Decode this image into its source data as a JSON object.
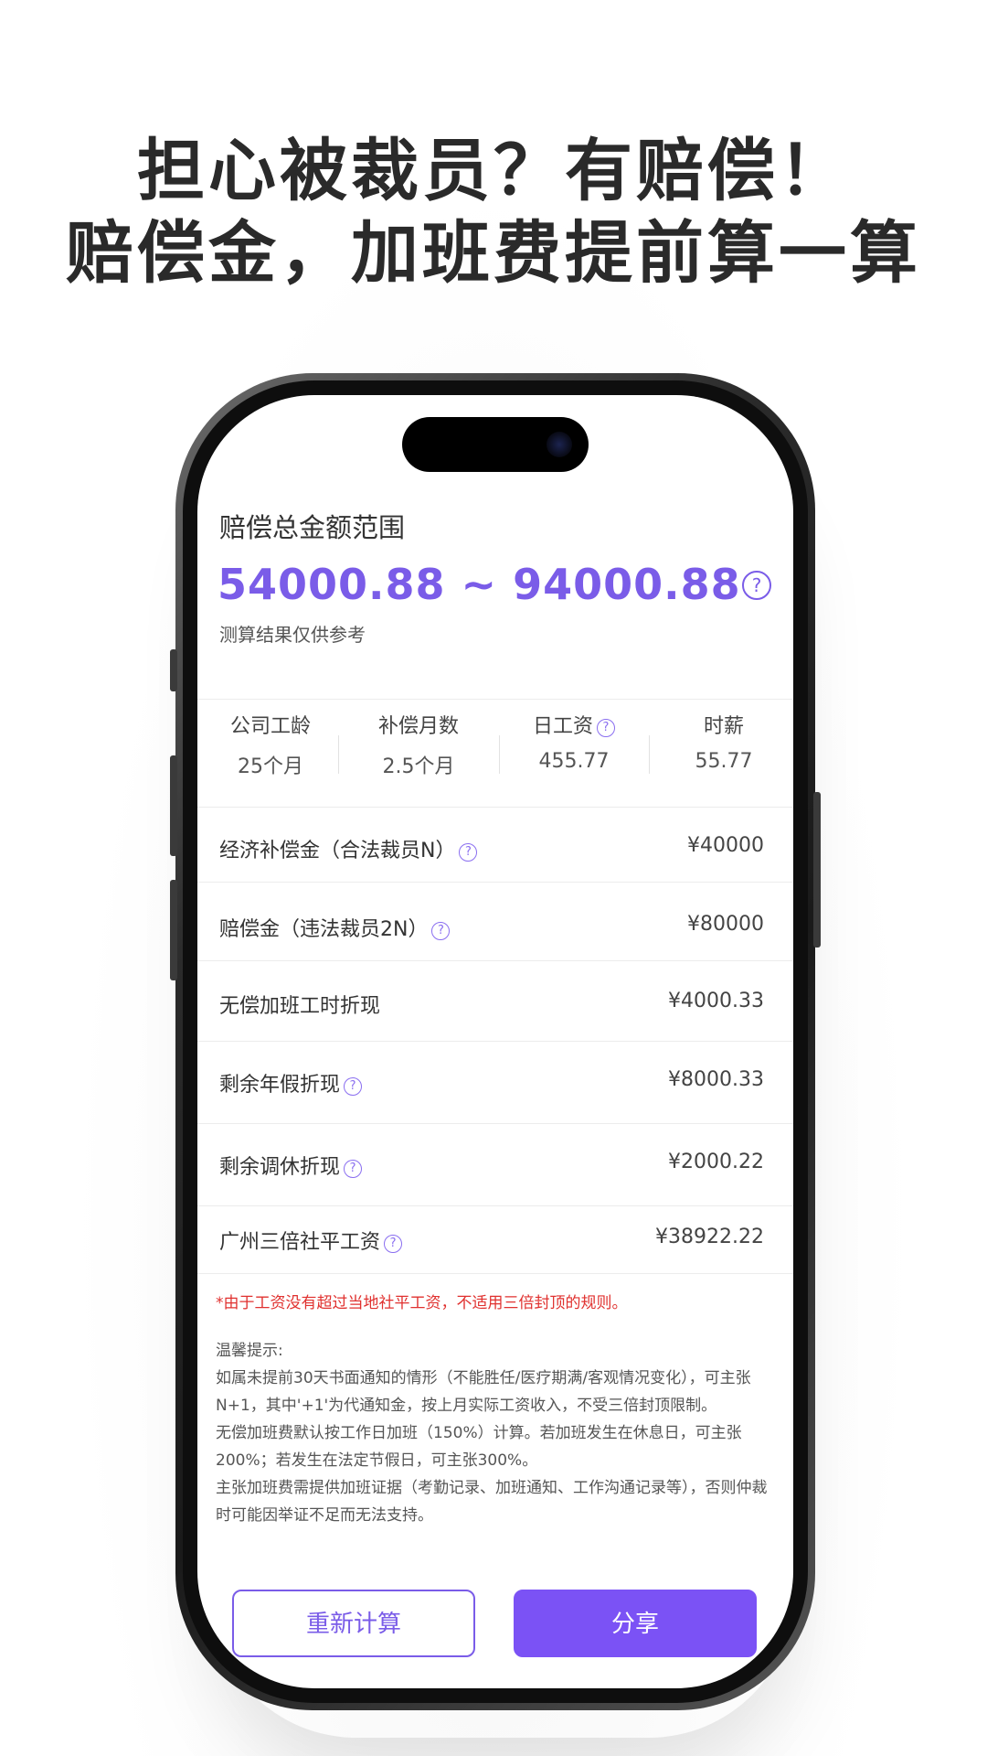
{
  "headline": {
    "line1": "担心被裁员？有赔偿！",
    "line2": "赔偿金，加班费提前算一算"
  },
  "result": {
    "title": "赔偿总金额范围",
    "amount": "54000.88 ~ 94000.88",
    "note": "测算结果仅供参考",
    "help_icon": "question-circle-icon"
  },
  "stats": [
    {
      "label": "公司工龄",
      "value": "25个月",
      "has_help": false
    },
    {
      "label": "补偿月数",
      "value": "2.5个月",
      "has_help": false
    },
    {
      "label": "日工资",
      "value": "455.77",
      "has_help": true
    },
    {
      "label": "时薪",
      "value": "55.77",
      "has_help": false
    }
  ],
  "rows": [
    {
      "label": "经济补偿金（合法裁员N）",
      "value": "¥40000",
      "has_help": true
    },
    {
      "label": "赔偿金（违法裁员2N）",
      "value": "¥80000",
      "has_help": true
    },
    {
      "label": "无偿加班工时折现",
      "value": "¥4000.33",
      "has_help": false
    },
    {
      "label": "剩余年假折现",
      "value": "¥8000.33",
      "has_help": true
    },
    {
      "label": "剩余调休折现",
      "value": "¥2000.22",
      "has_help": true
    },
    {
      "label": "广州三倍社平工资",
      "value": "¥38922.22",
      "has_help": true
    }
  ],
  "warning": "*由于工资没有超过当地社平工资，不适用三倍封顶的规则。",
  "tips": {
    "title": "温馨提示:",
    "p1": "如属未提前30天书面通知的情形（不能胜任/医疗期满/客观情况变化），可主张N+1，其中'+1'为代通知金，按上月实际工资收入，不受三倍封顶限制。",
    "p2": "无偿加班费默认按工作日加班（150%）计算。若加班发生在休息日，可主张200%；若发生在法定节假日，可主张300%。",
    "p3": "主张加班费需提供加班证据（考勤记录、加班通知、工作沟通记录等），否则仲裁时可能因举证不足而无法支持。"
  },
  "buttons": {
    "recalc": "重新计算",
    "share": "分享"
  },
  "colors": {
    "accent": "#7a5ce8",
    "button_fill": "#7b52f5",
    "warning": "#e0312f"
  }
}
